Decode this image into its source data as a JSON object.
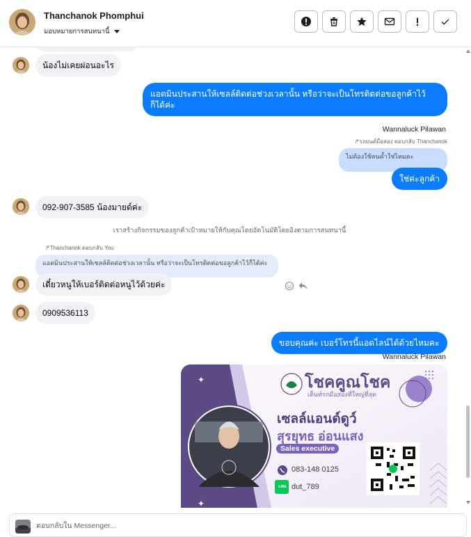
{
  "header": {
    "name": "Thanchanok Phomphui",
    "assign_label": "มอบหมายการสนทนานี้",
    "actions": [
      {
        "name": "alert-button",
        "icon": "exclamation-circle-icon"
      },
      {
        "name": "delete-button",
        "icon": "trash-icon"
      },
      {
        "name": "star-button",
        "icon": "star-icon"
      },
      {
        "name": "mail-button",
        "icon": "mail-icon"
      },
      {
        "name": "mark-spam-button",
        "icon": "exclamation-icon"
      },
      {
        "name": "mark-done-button",
        "icon": "check-icon"
      }
    ]
  },
  "messages": {
    "m1_text": "น้องไม่เคยผ่อนอะไร",
    "m2_text": "แอดมินประสานให้เซลล์ติดต่อช่วงเวลานั้น หรือว่าจะเป็นโทรติดต่อขอลูกค้าไว้ก็ได้ค่ะ",
    "m3_sender": "Wannaluck Pilawan",
    "m3_reply_info": "↱รถยนต์มือสอง ตอบกลับ Thanchanok",
    "m3_quote": "ไม่ต้องใช้คนค้ำใช่ไหมคะ",
    "m3_text": "ใช่ค่ะลูกค้า",
    "m4_text": "092-907-3585 น้องมายด์ค่ะ",
    "system_text": "เราสร้างกิจกรรมของลูกค้าเป้าหมายให้กับคุณโดยอัตโนมัติโดยอิงตามการสนทนานี้",
    "m5_reply_info": "↱Thanchanok ตอบกลับ You",
    "m5_quote": "แอดมินประสานให้เซลล์ติดต่อช่วงเวลานั้น หรือว่าจะเป็นโทรติดต่อขอลูกค้าไว้ก็ได้ค่ะ",
    "m5_text": "เดี๋ยวหนูให้เบอร์ติดต่อหนูไว้ด้วยค่ะ",
    "m6_text": "0909536113",
    "m7_text": "ขอบคุณค่ะ  เบอร์โทรนี้แอดไลน์ได้ด้วยไหมคะ",
    "m7_sender": "Wannaluck Pilawan"
  },
  "card": {
    "brand": "โชคคูณโชค",
    "tagline": "เต็นท์รถมือสองที่ใหญ่ที่สุด",
    "title": "เซลล์แอนด์ดูว์",
    "name": "สุรยุทธ  อ่อนแสง",
    "role": "Sales executive",
    "phone": "083-148 0125",
    "line_label": "LINE",
    "line_id": "dut_789",
    "colors": {
      "purple": "#5b4a86",
      "accent": "#7b62b8",
      "line_green": "#06c755"
    }
  },
  "composer": {
    "placeholder": "ตอบกลับใน Messenger..."
  }
}
